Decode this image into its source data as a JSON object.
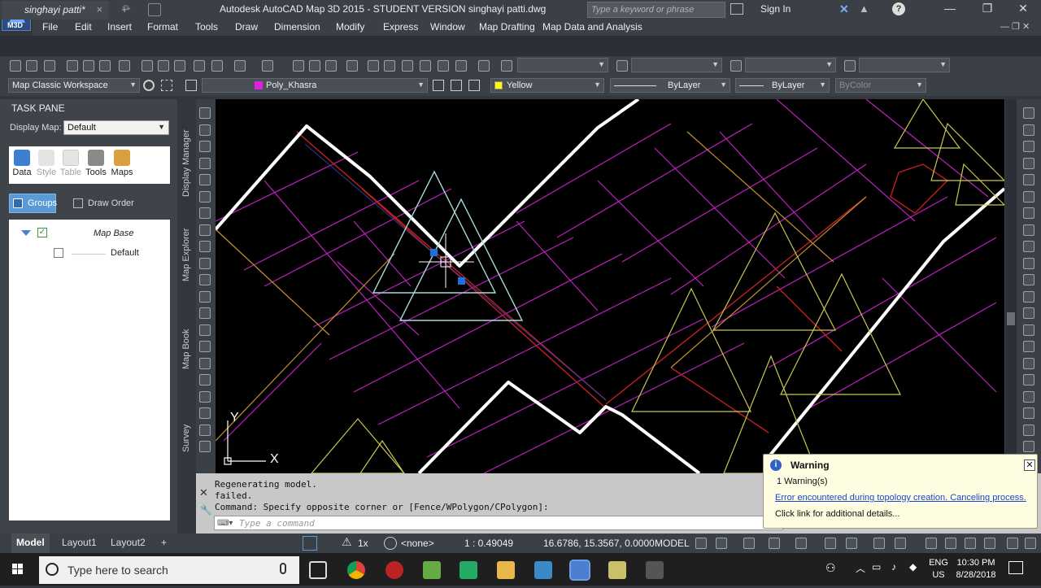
{
  "window": {
    "title": "Autodesk AutoCAD Map 3D 2015 - STUDENT VERSION    singhayi patti.dwg",
    "app_badge": "M3D",
    "search_placeholder": "Type a keyword or phrase",
    "sign_in": "Sign In"
  },
  "menu": [
    "File",
    "Edit",
    "Insert",
    "Format",
    "Tools",
    "Draw",
    "Dimension",
    "Modify",
    "Express",
    "Window",
    "Map Drafting",
    "Map Data and Analysis"
  ],
  "doc_tab": {
    "name": "singhayi patti*",
    "close": "×",
    "new": "+"
  },
  "toolbar2": {
    "workspace": "Map Classic Workspace",
    "layer": "Poly_Khasra",
    "color": "Yellow",
    "linetype": "ByLayer",
    "lineweight": "ByLayer",
    "plotstyle": "ByColor"
  },
  "taskpane": {
    "title": "TASK PANE",
    "display_map_label": "Display Map:",
    "display_map_value": "Default",
    "tools": [
      {
        "label": "Data",
        "icon": "database-icon",
        "color": "#3d7fd1"
      },
      {
        "label": "Style",
        "icon": "brush-icon",
        "color": "#d8d8d8"
      },
      {
        "label": "Table",
        "icon": "table-icon",
        "color": "#d8d8d8"
      },
      {
        "label": "Tools",
        "icon": "tools-icon",
        "color": "#6a6a6a"
      },
      {
        "label": "Maps",
        "icon": "map-icon",
        "color": "#d9a040"
      }
    ],
    "groups_label": "Groups",
    "draw_order_label": "Draw Order",
    "layers": {
      "group": "Map Base",
      "item": "Default"
    }
  },
  "vertical_tabs": [
    "Display Manager",
    "Map Explorer",
    "Map Book",
    "Survey"
  ],
  "command": {
    "lines": [
      "Regenerating model.",
      "failed.",
      "Command: Specify opposite corner or [Fence/WPolygon/CPolygon]:"
    ],
    "placeholder": "Type a command"
  },
  "status": {
    "tabs": [
      "Model",
      "Layout1",
      "Layout2"
    ],
    "scale_factor": "1x",
    "coord_system": "<none>",
    "scale": "1 : 0.49049",
    "coordinates": "16.6786, 15.3567, 0.0000",
    "space": "MODEL"
  },
  "warning": {
    "title": "Warning",
    "count": "1 Warning(s)",
    "link": "Error encountered during topology creation.  Canceling process.",
    "detail": "Click link for additional details..."
  },
  "taskbar": {
    "search_placeholder": "Type here to search",
    "lang": "ENG",
    "region": "US",
    "time": "10:30 PM",
    "date": "8/28/2018"
  },
  "colors": {
    "magenta": "#c020c0",
    "yellow": "#c8c850",
    "white": "#ffffff",
    "red": "#c02020",
    "cyan": "#a8d8d8",
    "accent": "#5b9bd5"
  }
}
